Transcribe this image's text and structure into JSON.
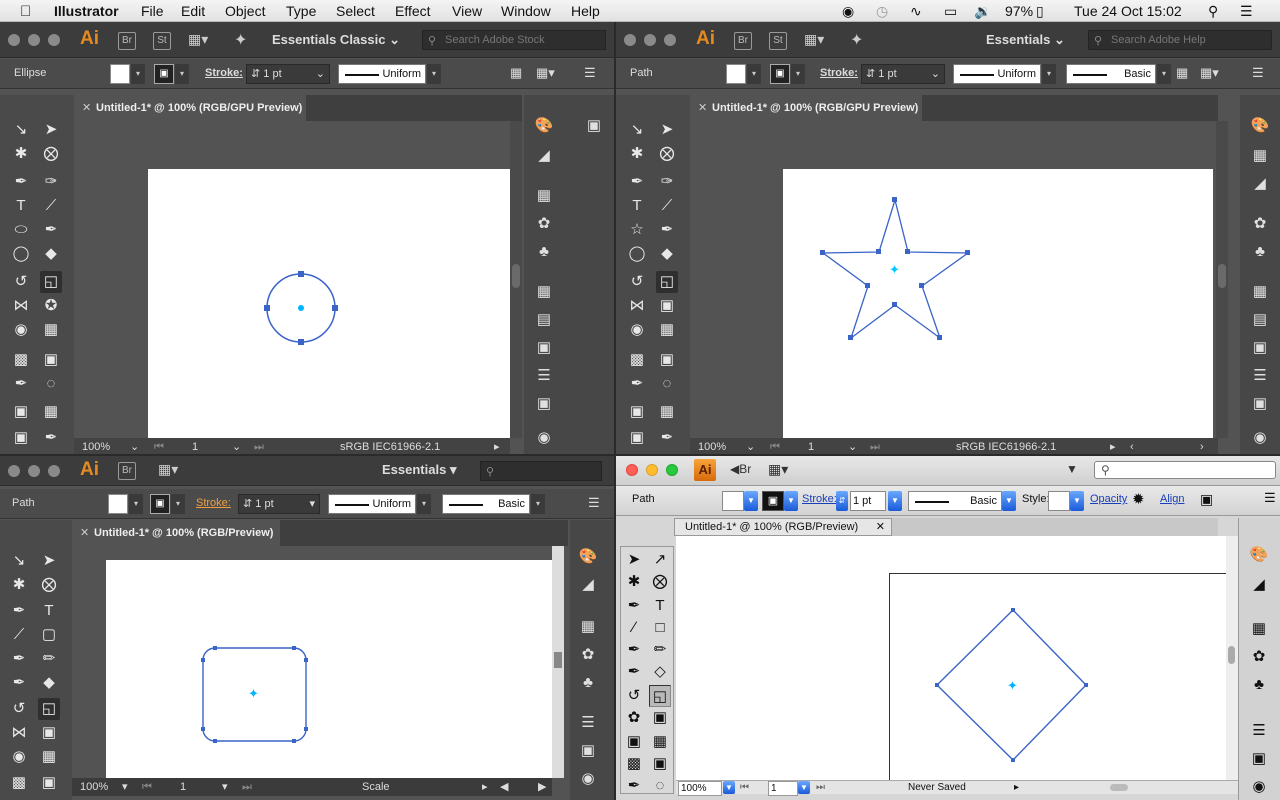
{
  "menubar": {
    "app": "Illustrator",
    "items": [
      "File",
      "Edit",
      "Object",
      "Type",
      "Select",
      "Effect",
      "View",
      "Window",
      "Help"
    ],
    "battery": "97%",
    "clock": "Tue 24 Oct  15:02"
  },
  "win_tl": {
    "workspace": "Essentials Classic",
    "search_placeholder": "Search Adobe Stock",
    "br": "Br",
    "st": "St",
    "selection": "Ellipse",
    "stroke_label": "Stroke:",
    "stroke_value": "1 pt",
    "brush": "Uniform",
    "tab": "Untitled-1* @ 100% (RGB/GPU Preview)",
    "zoom": "100%",
    "page": "1",
    "profile": "sRGB IEC61966-2.1"
  },
  "win_tr": {
    "workspace": "Essentials",
    "search_placeholder": "Search Adobe Help",
    "br": "Br",
    "st": "St",
    "selection": "Path",
    "stroke_label": "Stroke:",
    "stroke_value": "1 pt",
    "brush": "Uniform",
    "style": "Basic",
    "tab": "Untitled-1* @ 100% (RGB/GPU Preview)",
    "zoom": "100%",
    "page": "1",
    "profile": "sRGB IEC61966-2.1"
  },
  "win_bl": {
    "workspace": "Essentials",
    "br": "Br",
    "selection": "Path",
    "stroke_label": "Stroke:",
    "stroke_value": "1 pt",
    "brush": "Uniform",
    "style": "Basic",
    "tab": "Untitled-1* @ 100% (RGB/Preview)",
    "zoom": "100%",
    "page": "1",
    "status": "Scale"
  },
  "win_br": {
    "br": "Br",
    "selection": "Path",
    "stroke_label": "Stroke:",
    "stroke_value": "1 pt",
    "brush": "Basic",
    "style_label": "Style:",
    "opacity": "Opacity",
    "align": "Align",
    "tab": "Untitled-1* @ 100% (RGB/Preview)",
    "zoom": "100%",
    "page": "1",
    "status": "Never Saved"
  },
  "app_logo": "Ai",
  "colors": {
    "accent": "#e58a1e",
    "selection": "#3a64c8",
    "center": "#00b4ff"
  }
}
